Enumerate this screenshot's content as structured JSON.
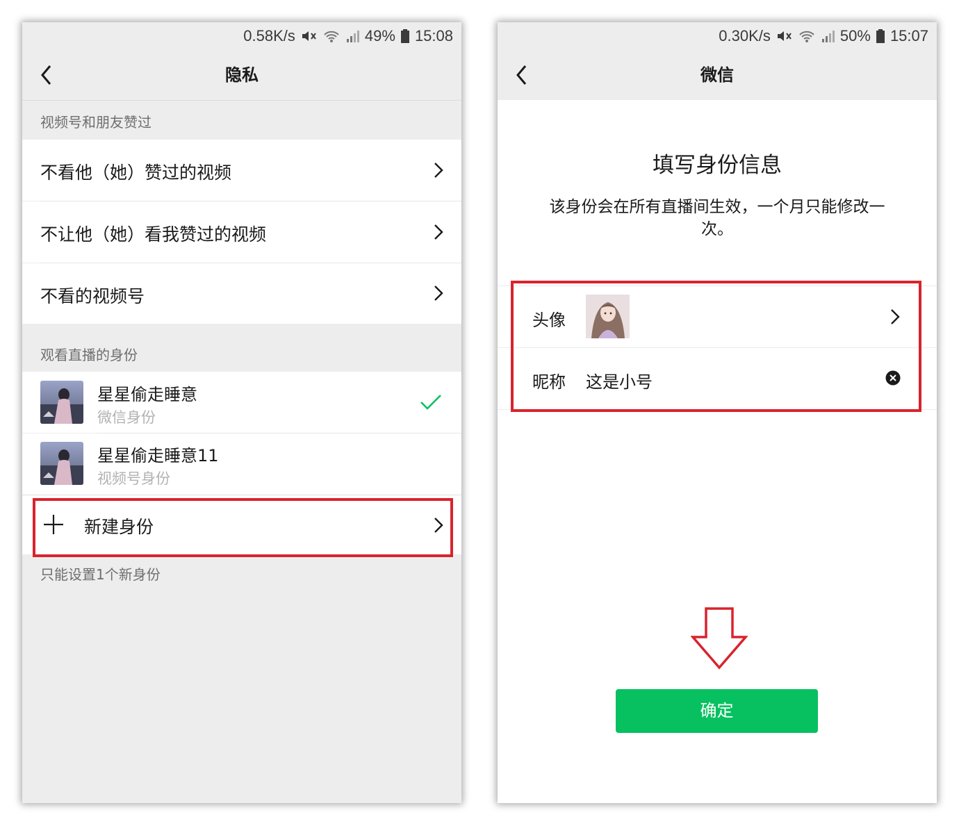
{
  "left_screen": {
    "status": {
      "speed": "0.58K/s",
      "battery": "49%",
      "time": "15:08"
    },
    "title": "隐私",
    "section1_header": "视频号和朋友赞过",
    "items": [
      {
        "label": "不看他（她）赞过的视频"
      },
      {
        "label": "不让他（她）看我赞过的视频"
      },
      {
        "label": "不看的视频号"
      }
    ],
    "section2_header": "观看直播的身份",
    "identities": [
      {
        "name": "星星偷走睡意",
        "type": "微信身份",
        "selected": true
      },
      {
        "name": "星星偷走睡意11",
        "type": "视频号身份",
        "selected": false
      }
    ],
    "new_identity": {
      "icon": "plus-icon",
      "label": "新建身份"
    },
    "footer_note": "只能设置1个新身份"
  },
  "right_screen": {
    "status": {
      "speed": "0.30K/s",
      "battery": "50%",
      "time": "15:07"
    },
    "title": "微信",
    "heading": "填写身份信息",
    "description": "该身份会在所有直播间生效，一个月只能修改一次。",
    "avatar_label": "头像",
    "nickname_label": "昵称",
    "nickname_value": "这是小号",
    "confirm_label": "确定"
  },
  "colors": {
    "accent": "#07c160",
    "highlight": "#d9232d",
    "background": "#ededed"
  }
}
